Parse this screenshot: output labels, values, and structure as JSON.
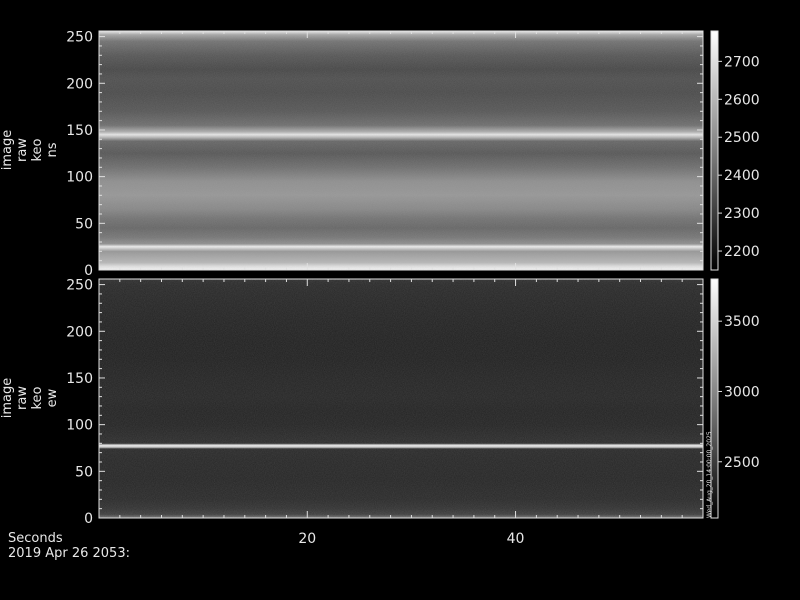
{
  "footer": {
    "x_axis_label": "Seconds",
    "timestamp": "2019 Apr 26 2053:"
  },
  "side_stamp": "Wed_Aug_20_14:00:00_2025",
  "chart_data": [
    {
      "type": "heatmap",
      "title": "",
      "ylabel_lines": [
        "image",
        "raw",
        "keo",
        "ns"
      ],
      "xlabel": "Seconds",
      "xlim": [
        0,
        58
      ],
      "ylim": [
        0,
        256
      ],
      "x_ticks": [
        20,
        40
      ],
      "y_ticks": [
        0,
        50,
        100,
        150,
        200,
        250
      ],
      "colorbar": {
        "min": 2150,
        "max": 2780,
        "ticks": [
          2200,
          2300,
          2400,
          2500,
          2600,
          2700
        ],
        "colormap": "grayscale"
      },
      "row_profile": [
        {
          "y": 0,
          "v": 2760
        },
        {
          "y": 4,
          "v": 2700
        },
        {
          "y": 8,
          "v": 2600
        },
        {
          "y": 14,
          "v": 2560
        },
        {
          "y": 20,
          "v": 2520
        },
        {
          "y": 25,
          "v": 2740
        },
        {
          "y": 28,
          "v": 2500
        },
        {
          "y": 35,
          "v": 2440
        },
        {
          "y": 45,
          "v": 2400
        },
        {
          "y": 55,
          "v": 2430
        },
        {
          "y": 65,
          "v": 2480
        },
        {
          "y": 80,
          "v": 2520
        },
        {
          "y": 95,
          "v": 2500
        },
        {
          "y": 110,
          "v": 2420
        },
        {
          "y": 125,
          "v": 2360
        },
        {
          "y": 138,
          "v": 2400
        },
        {
          "y": 142,
          "v": 2600
        },
        {
          "y": 145,
          "v": 2720
        },
        {
          "y": 148,
          "v": 2580
        },
        {
          "y": 155,
          "v": 2420
        },
        {
          "y": 170,
          "v": 2360
        },
        {
          "y": 190,
          "v": 2330
        },
        {
          "y": 205,
          "v": 2340
        },
        {
          "y": 215,
          "v": 2320
        },
        {
          "y": 230,
          "v": 2360
        },
        {
          "y": 245,
          "v": 2430
        },
        {
          "y": 252,
          "v": 2560
        },
        {
          "y": 256,
          "v": 2740
        }
      ]
    },
    {
      "type": "heatmap",
      "title": "",
      "ylabel_lines": [
        "image",
        "raw",
        "keo",
        "ew"
      ],
      "xlabel": "Seconds",
      "xlim": [
        0,
        58
      ],
      "ylim": [
        0,
        256
      ],
      "x_ticks": [
        20,
        40
      ],
      "y_ticks": [
        0,
        50,
        100,
        150,
        200,
        250
      ],
      "colorbar": {
        "min": 2100,
        "max": 3800,
        "ticks": [
          2500,
          3000,
          3500
        ],
        "colormap": "grayscale"
      },
      "row_profile": [
        {
          "y": 0,
          "v": 2900
        },
        {
          "y": 4,
          "v": 2500
        },
        {
          "y": 10,
          "v": 2420
        },
        {
          "y": 20,
          "v": 2360
        },
        {
          "y": 40,
          "v": 2330
        },
        {
          "y": 60,
          "v": 2340
        },
        {
          "y": 74,
          "v": 2360
        },
        {
          "y": 76,
          "v": 3500
        },
        {
          "y": 78,
          "v": 3650
        },
        {
          "y": 80,
          "v": 2380
        },
        {
          "y": 100,
          "v": 2320
        },
        {
          "y": 115,
          "v": 2310
        },
        {
          "y": 130,
          "v": 2330
        },
        {
          "y": 150,
          "v": 2320
        },
        {
          "y": 170,
          "v": 2300
        },
        {
          "y": 190,
          "v": 2300
        },
        {
          "y": 210,
          "v": 2310
        },
        {
          "y": 230,
          "v": 2330
        },
        {
          "y": 250,
          "v": 2360
        },
        {
          "y": 256,
          "v": 2400
        }
      ]
    }
  ]
}
